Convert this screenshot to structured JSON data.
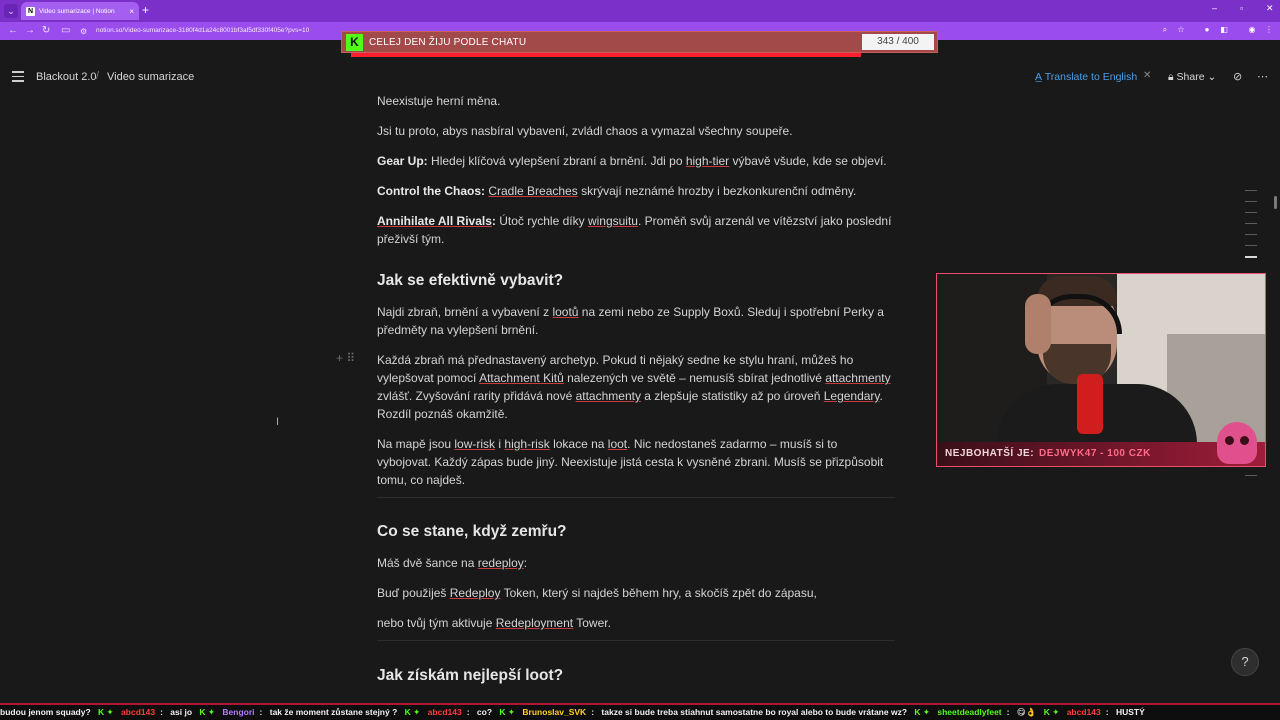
{
  "browser": {
    "tab_title": "Video sumarizace | Notion",
    "tab_favicon": "N",
    "url": "notion.so/Video-sumarizace-3180f4d1a24c8001bf3af5df330f405e?pvs=10"
  },
  "overlay_goal": {
    "icon_letter": "K",
    "label": "CELEJ DEN ŽIJU PODLE CHATU",
    "count": "343 / 400",
    "color": "#a24a4a"
  },
  "topbar": {
    "crumbs": [
      "Blackout 2.0",
      "Video sumarizace"
    ],
    "translate_label": "Translate to English",
    "share_label": "Share",
    "accent": "#4b9eea"
  },
  "doc": {
    "p1": "Neexistuje herní měna.",
    "p2": "Jsi tu proto, abys nasbíral vybavení, zvládl chaos a vymazal všechny soupeře.",
    "p3_label": "Gear Up:",
    "p3_pre": " Hledej klíčová vylepšení zbraní a brnění. Jdi po ",
    "p3_u": "high-tier",
    "p3_post": " výbavě všude, kde se objeví.",
    "p4_label": "Control the Chaos:",
    "p4_u": "Cradle Breaches",
    "p4_post": " skrývají neznámé hrozby i bezkonkurenční odměny.",
    "p5_label": "Annihilate All Rivals",
    "p5_colon": ":",
    "p5_pre": " Útoč rychle díky ",
    "p5_u": "wingsuitu",
    "p5_post": ". Proměň svůj arzenál ve vítězství jako poslední přeživší tým.",
    "h1": "Jak se efektivně vybavit?",
    "p6_pre": "Najdi zbraň, brnění a vybavení z ",
    "p6_u": "lootů",
    "p6_post": " na zemi nebo ze Supply Boxů. Sleduj i spotřební Perky a předměty na vylepšení brnění.",
    "p7_a": "Každá zbraň má přednastavený archetyp. Pokud ti nějaký sedne ke stylu hraní, můžeš ho vylepšovat pomocí ",
    "p7_u1": "Attachment Kitů",
    "p7_b": " nalezených ve světě – nemusíš sbírat jednotlivé ",
    "p7_u2": "attachmenty",
    "p7_c": " zvlášť. Zvyšování rarity přidává nové ",
    "p7_u3": "attachmenty",
    "p7_d": " a zlepšuje statistiky až po úroveň ",
    "p7_u4": "Legendary",
    "p7_e": ". Rozdíl poznáš okamžitě.",
    "p8_a": "Na mapě jsou ",
    "p8_u1": "low-risk",
    "p8_b": " i ",
    "p8_u2": "high-risk",
    "p8_c": " lokace na ",
    "p8_u3": "loot",
    "p8_d": ". Nic nedostaneš zadarmo – musíš si to vybojovat. Každý zápas bude jiný. Neexistuje jistá cesta k vysněné zbrani. Musíš se přizpůsobit tomu, co najdeš.",
    "h2": "Co se stane, když zemřu?",
    "p9_pre": "Máš dvě šance na ",
    "p9_u": "redeploy",
    "p9_post": ":",
    "p10_pre": "Buď použiješ ",
    "p10_u": "Redeploy",
    "p10_post": " Token, který si najdeš během hry, a skočíš zpět do zápasu,",
    "p11_pre": "nebo tvůj tým aktivuje ",
    "p11_u": "Redeployment",
    "p11_post": " Tower.",
    "h3": "Jak získám nejlepší loot?"
  },
  "webcam": {
    "label": "NEJBOHATŠÍ JE:",
    "value": "DEJWYK47 - 100 CZK"
  },
  "help_button": {
    "icon": "?"
  },
  "ticker": [
    {
      "name": "",
      "msg": "budou jenom squady?"
    },
    {
      "name": "abcd143",
      "msg": "asi jo"
    },
    {
      "name": "Bengori",
      "msg": "tak že moment zůstane stejný ?"
    },
    {
      "name": "abcd143",
      "msg": "co?"
    },
    {
      "name": "Brunoslav_SVK",
      "msg": "takze si bude treba stiahnut samostatne bo royal alebo to bude vrátane wz?"
    },
    {
      "name": "sheetdeadlyfeet",
      "msg": "😋👌"
    },
    {
      "name": "abcd143",
      "msg": "HUSTÝ"
    }
  ]
}
